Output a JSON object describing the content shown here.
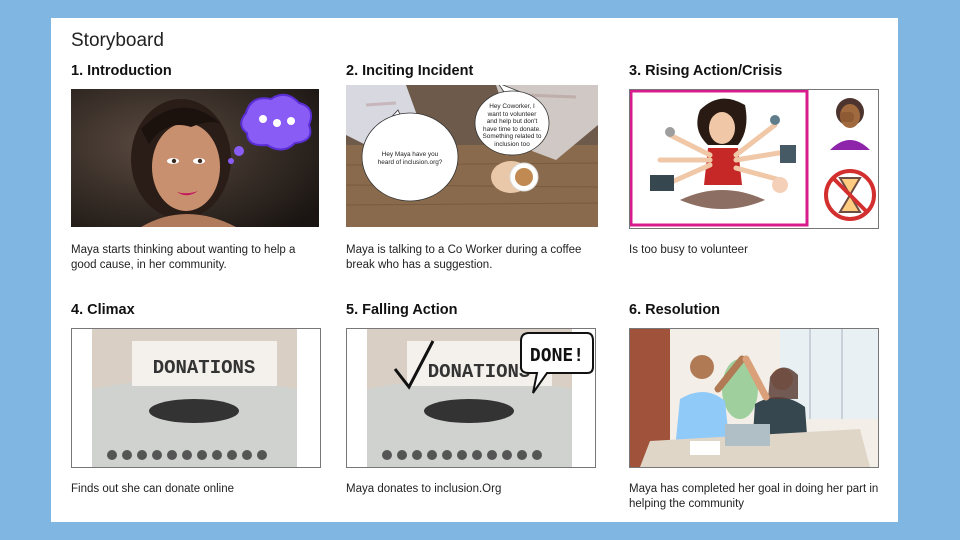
{
  "title": "Storyboard",
  "panels": [
    {
      "heading": "1. Introduction",
      "caption": "Maya starts thinking about wanting to help a good cause, in her community."
    },
    {
      "heading": "2. Inciting Incident",
      "caption": "Maya is talking to a Co Worker during a coffee break who has a suggestion.",
      "bubble_left": "Hey Maya have you heard of inclusion.org?",
      "bubble_right": "Hey Coworker, I want to volunteer and help but don't have time to donate. Something related to inclusion too"
    },
    {
      "heading": "3. Rising Action/Crisis",
      "caption": "Is too busy to volunteer"
    },
    {
      "heading": "4. Climax",
      "caption": "Finds out she can donate online",
      "sign": "DONATIONS"
    },
    {
      "heading": "5. Falling Action",
      "caption": "Maya donates to inclusion.Org",
      "sign": "DONATIONS",
      "stamp": "DONE!"
    },
    {
      "heading": "6. Resolution",
      "caption": "Maya has completed her goal in doing her part in helping the community"
    }
  ],
  "colors": {
    "background": "#7fb6e2",
    "slide": "#ffffff",
    "accent_magenta": "#d81b8c",
    "thought_bubble": "#8a5cf6"
  }
}
